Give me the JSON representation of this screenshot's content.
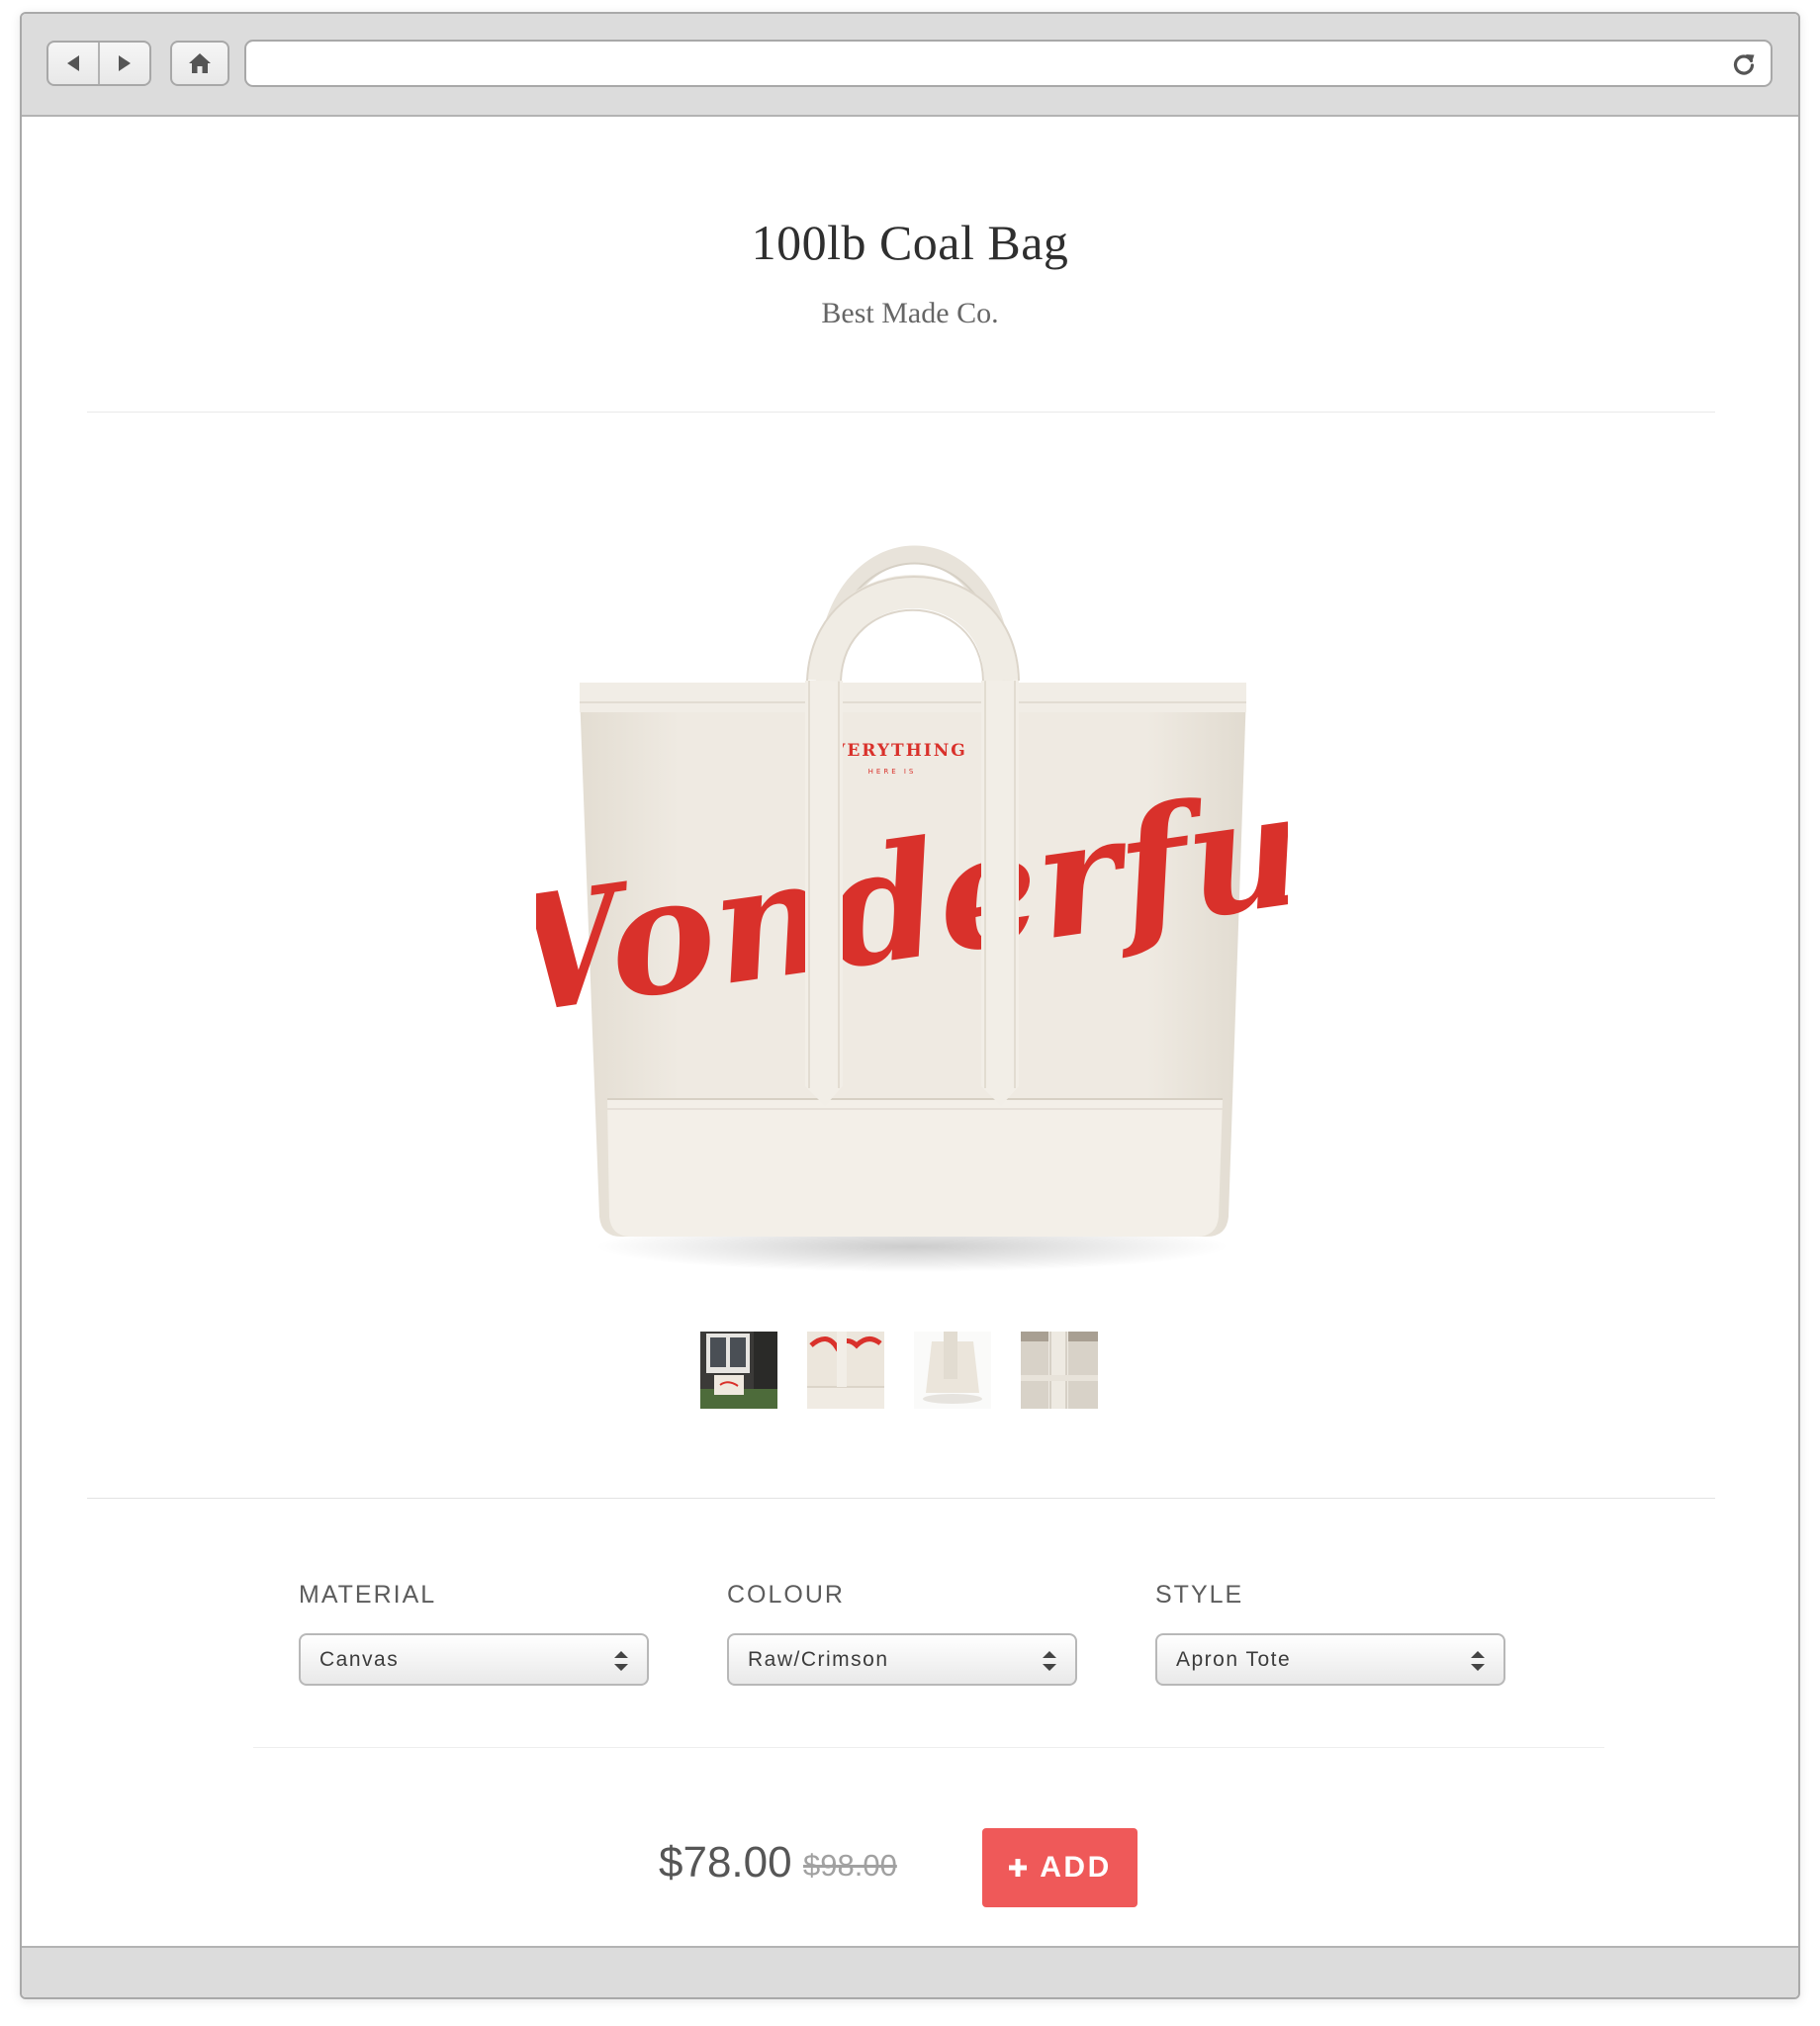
{
  "browser": {
    "address_value": "",
    "icons": [
      "back-arrow-icon",
      "forward-arrow-icon",
      "home-icon",
      "reload-icon"
    ]
  },
  "product": {
    "title": "100lb Coal Bag",
    "brand": "Best Made Co.",
    "hero_print": {
      "top_line": "EVERYTHING",
      "small_line": "HERE IS",
      "script": "Wonderful"
    },
    "thumbnails": [
      "lifestyle-porch",
      "print-closeup",
      "base-detail",
      "strap-detail"
    ]
  },
  "options": {
    "material": {
      "label": "MATERIAL",
      "value": "Canvas"
    },
    "colour": {
      "label": "COLOUR",
      "value": "Raw/Crimson"
    },
    "style": {
      "label": "STYLE",
      "value": "Apron Tote"
    }
  },
  "purchase": {
    "price": "$78.00",
    "old_price": "$98.00",
    "add_label": "ADD"
  },
  "colors": {
    "accent": "#ef5959",
    "print_red": "#d9312b",
    "canvas": "#ede8df"
  }
}
